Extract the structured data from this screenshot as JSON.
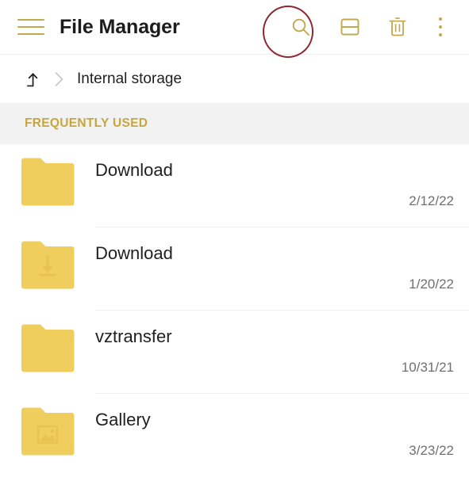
{
  "app_bar": {
    "menu_icon": "hamburger-menu-icon",
    "title": "File Manager",
    "actions": [
      {
        "name": "search-button",
        "icon": "search-icon",
        "annotated": true
      },
      {
        "name": "view-toggle-button",
        "icon": "split-view-icon",
        "annotated": false
      },
      {
        "name": "delete-button",
        "icon": "trash-icon",
        "annotated": false
      },
      {
        "name": "overflow-menu-button",
        "icon": "more-vertical-icon",
        "annotated": false
      }
    ],
    "annotation_color": "#8e2a33"
  },
  "breadcrumb": {
    "up_icon": "arrow-up-level-icon",
    "separator_icon": "chevron-right-icon",
    "label": "Internal storage"
  },
  "section": {
    "label": "FREQUENTLY USED",
    "label_color": "#c8a63e",
    "background_color": "#f2f2f2"
  },
  "files": [
    {
      "name": "Download",
      "date": "2/12/22",
      "icon": "folder-icon"
    },
    {
      "name": "Download",
      "date": "1/20/22",
      "icon": "folder-download-icon"
    },
    {
      "name": "vztransfer",
      "date": "10/31/21",
      "icon": "folder-icon"
    },
    {
      "name": "Gallery",
      "date": "3/23/22",
      "icon": "folder-image-icon"
    }
  ],
  "colors": {
    "folder": "#f0ce5e",
    "folder_shade": "#e9c352",
    "accent_gold": "#c3a84f",
    "text_primary": "#202020",
    "text_secondary": "#6f7072"
  }
}
